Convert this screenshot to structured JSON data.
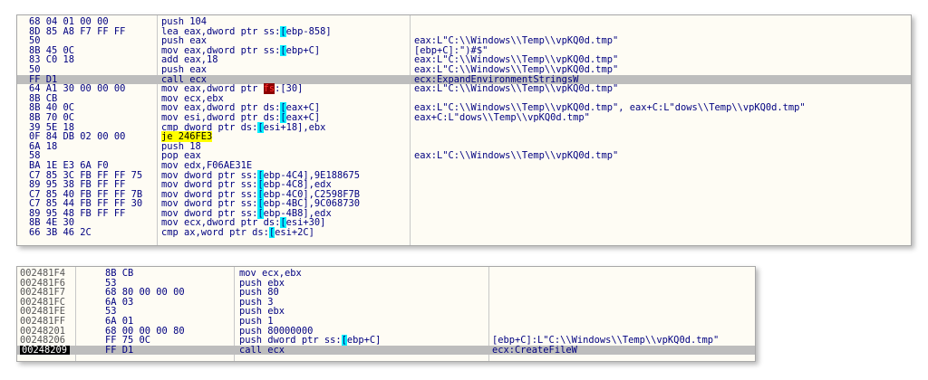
{
  "panel1": {
    "rows": [
      {
        "hex": "68 04 01 00 00",
        "dis": [
          {
            "t": "push 104"
          }
        ],
        "cmt": ""
      },
      {
        "hex": "8D 85 A8 F7 FF FF",
        "dis": [
          {
            "t": "lea eax,dword ptr ss:"
          },
          {
            "t": "[",
            "hl": "cyan"
          },
          {
            "t": "ebp-858]"
          }
        ],
        "cmt": ""
      },
      {
        "hex": "50",
        "dis": [
          {
            "t": "push eax"
          }
        ],
        "cmt": "eax:L\"C:\\\\Windows\\\\Temp\\\\vpKQ0d.tmp\""
      },
      {
        "hex": "8B 45 0C",
        "dis": [
          {
            "t": "mov eax,dword ptr ss:"
          },
          {
            "t": "[",
            "hl": "cyan"
          },
          {
            "t": "ebp+C]"
          }
        ],
        "cmt": "[ebp+C]:\")#$\""
      },
      {
        "hex": "83 C0 18",
        "dis": [
          {
            "t": "add eax,18"
          }
        ],
        "cmt": "eax:L\"C:\\\\Windows\\\\Temp\\\\vpKQ0d.tmp\""
      },
      {
        "hex": "50",
        "dis": [
          {
            "t": "push eax"
          }
        ],
        "cmt": "eax:L\"C:\\\\Windows\\\\Temp\\\\vpKQ0d.tmp\""
      },
      {
        "hex": "FF D1",
        "dis": [
          {
            "t": "call ecx"
          }
        ],
        "cmt": "ecx:ExpandEnvironmentStringsW",
        "selected": true
      },
      {
        "hex": "64 A1 30 00 00 00",
        "dis": [
          {
            "t": "mov eax,dword ptr "
          },
          {
            "t": "fs",
            "hl": "fs"
          },
          {
            "t": ":[30]"
          }
        ],
        "cmt": "eax:L\"C:\\\\Windows\\\\Temp\\\\vpKQ0d.tmp\""
      },
      {
        "hex": "8B CB",
        "dis": [
          {
            "t": "mov ecx,ebx"
          }
        ],
        "cmt": ""
      },
      {
        "hex": "8B 40 0C",
        "dis": [
          {
            "t": "mov eax,dword ptr ds:"
          },
          {
            "t": "[",
            "hl": "cyan"
          },
          {
            "t": "eax+C]"
          }
        ],
        "cmt": "eax:L\"C:\\\\Windows\\\\Temp\\\\vpKQ0d.tmp\", eax+C:L\"dows\\\\Temp\\\\vpKQ0d.tmp\""
      },
      {
        "hex": "8B 70 0C",
        "dis": [
          {
            "t": "mov esi,dword ptr ds:"
          },
          {
            "t": "[",
            "hl": "cyan"
          },
          {
            "t": "eax+C]"
          }
        ],
        "cmt": "eax+C:L\"dows\\\\Temp\\\\vpKQ0d.tmp\""
      },
      {
        "hex": "39 5E 18",
        "dis": [
          {
            "t": "cmp dword ptr ds:"
          },
          {
            "t": "[",
            "hl": "cyan"
          },
          {
            "t": "esi+18],ebx"
          }
        ],
        "cmt": ""
      },
      {
        "hex": "0F 84 DB 02 00 00",
        "dis": [
          {
            "t": "je 246FE3",
            "hl": "yellow"
          }
        ],
        "cmt": ""
      },
      {
        "hex": "6A 18",
        "dis": [
          {
            "t": "push 18"
          }
        ],
        "cmt": ""
      },
      {
        "hex": "58",
        "dis": [
          {
            "t": "pop eax"
          }
        ],
        "cmt": "eax:L\"C:\\\\Windows\\\\Temp\\\\vpKQ0d.tmp\""
      },
      {
        "hex": "BA 1E E3 6A F0",
        "dis": [
          {
            "t": "mov edx,F06AE31E"
          }
        ],
        "cmt": ""
      },
      {
        "hex": "C7 85 3C FB FF FF 75",
        "dis": [
          {
            "t": "mov dword ptr ss:"
          },
          {
            "t": "[",
            "hl": "cyan"
          },
          {
            "t": "ebp-4C4],9E188675"
          }
        ],
        "cmt": ""
      },
      {
        "hex": "89 95 38 FB FF FF",
        "dis": [
          {
            "t": "mov dword ptr ss:"
          },
          {
            "t": "[",
            "hl": "cyan"
          },
          {
            "t": "ebp-4C8],edx"
          }
        ],
        "cmt": ""
      },
      {
        "hex": "C7 85 40 FB FF FF 7B",
        "dis": [
          {
            "t": "mov dword ptr ss:"
          },
          {
            "t": "[",
            "hl": "cyan"
          },
          {
            "t": "ebp-4C0],C2598F7B"
          }
        ],
        "cmt": ""
      },
      {
        "hex": "C7 85 44 FB FF FF 30",
        "dis": [
          {
            "t": "mov dword ptr ss:"
          },
          {
            "t": "[",
            "hl": "cyan"
          },
          {
            "t": "ebp-4BC],9C068730"
          }
        ],
        "cmt": ""
      },
      {
        "hex": "89 95 48 FB FF FF",
        "dis": [
          {
            "t": "mov dword ptr ss:"
          },
          {
            "t": "[",
            "hl": "cyan"
          },
          {
            "t": "ebp-4B8],edx"
          }
        ],
        "cmt": ""
      },
      {
        "hex": "8B 4E 30",
        "dis": [
          {
            "t": "mov ecx,dword ptr ds:"
          },
          {
            "t": "[",
            "hl": "cyan"
          },
          {
            "t": "esi+30]"
          }
        ],
        "cmt": ""
      },
      {
        "hex": "66 3B 46 2C",
        "dis": [
          {
            "t": "cmp ax,word ptr ds:"
          },
          {
            "t": "[",
            "hl": "cyan"
          },
          {
            "t": "esi+2C]"
          }
        ],
        "cmt": ""
      }
    ]
  },
  "panel2": {
    "rows": [
      {
        "addr": "002481F4",
        "hex": "8B CB",
        "dis": [
          {
            "t": "mov ecx,ebx"
          }
        ],
        "cmt": ""
      },
      {
        "addr": "002481F6",
        "hex": "53",
        "dis": [
          {
            "t": "push ebx"
          }
        ],
        "cmt": ""
      },
      {
        "addr": "002481F7",
        "hex": "68 80 00 00 00",
        "dis": [
          {
            "t": "push 80"
          }
        ],
        "cmt": ""
      },
      {
        "addr": "002481FC",
        "hex": "6A 03",
        "dis": [
          {
            "t": "push 3"
          }
        ],
        "cmt": ""
      },
      {
        "addr": "002481FE",
        "hex": "53",
        "dis": [
          {
            "t": "push ebx"
          }
        ],
        "cmt": ""
      },
      {
        "addr": "002481FF",
        "hex": "6A 01",
        "dis": [
          {
            "t": "push 1"
          }
        ],
        "cmt": ""
      },
      {
        "addr": "00248201",
        "hex": "68 00 00 00 80",
        "dis": [
          {
            "t": "push 80000000"
          }
        ],
        "cmt": ""
      },
      {
        "addr": "00248206",
        "hex": "FF 75 0C",
        "dis": [
          {
            "t": "push dword ptr ss:"
          },
          {
            "t": "[",
            "hl": "cyan"
          },
          {
            "t": "ebp+C]"
          }
        ],
        "cmt": "[ebp+C]:L\"C:\\\\Windows\\\\Temp\\\\vpKQ0d.tmp\""
      },
      {
        "addr": "00248209",
        "hex": "FF D1",
        "dis": [
          {
            "t": "call ecx"
          }
        ],
        "cmt": "ecx:CreateFileW",
        "selected": true
      }
    ]
  },
  "colors": {
    "panel_bg": "#fefcf4",
    "text": "#000080",
    "selected_row": "#bdbdbd",
    "bracket_highlight": "#00f0ff",
    "jump_highlight": "#ffff00",
    "segment_highlight": "#8b0000"
  }
}
